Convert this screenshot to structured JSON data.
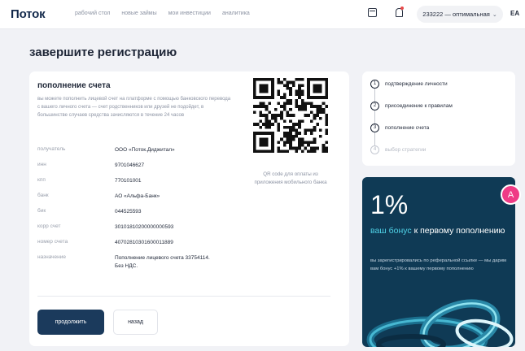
{
  "header": {
    "logo": "Поток",
    "nav": [
      "рабочий стол",
      "новые займы",
      "мои инвестиции",
      "аналитика"
    ],
    "account_label": "233222 — оптимальная",
    "user_initials": "EA"
  },
  "page": {
    "title": "завершите регистрацию"
  },
  "funding": {
    "title": "пополнение счета",
    "description": "вы можете пополнить лицевой счет на платформе с помощью банковского перевода с вашего личного счета — счет родственников или друзей не подойдет, в большинстве случаев средства зачисляются в течение 24 часов",
    "qr_caption": "QR code для оплаты из приложения мобильного банка",
    "details": [
      {
        "label": "получатель",
        "value": "ООО «Поток.Диджитал»"
      },
      {
        "label": "инн",
        "value": "9701046627"
      },
      {
        "label": "кпп",
        "value": "770101001"
      },
      {
        "label": "банк",
        "value": "АО «Альфа-Банк»"
      },
      {
        "label": "бик",
        "value": "044525593"
      },
      {
        "label": "корр счет",
        "value": "30101810200000000593"
      },
      {
        "label": "номер счета",
        "value": "40702810301600011889"
      },
      {
        "label": "назначение",
        "value": "Пополнение лицевого счета 33754114. Без НДС."
      }
    ],
    "continue_label": "продолжить",
    "back_label": "назад"
  },
  "steps": [
    {
      "num": "1",
      "label": "подтверждение личности",
      "active": true
    },
    {
      "num": "2",
      "label": "присоединение к правилам",
      "active": true
    },
    {
      "num": "3",
      "label": "пополнение счета",
      "active": true
    },
    {
      "num": "4",
      "label": "выбор стратегии",
      "active": false
    }
  ],
  "promo": {
    "big": "1%",
    "accent": "ваш бонус",
    "headline_rest": " к первому пополнению",
    "text": "вы зарегистрировались по реферальной ссылке — мы дарим вам бонус +1% к вашему первому пополнению"
  },
  "chat_badge": "A",
  "colors": {
    "primary": "#1b3a5c",
    "promo_bg": "#0f3a55",
    "accent": "#4fd1e6",
    "badge": "#ef3b86"
  },
  "icons": {
    "calendar": "calendar-icon",
    "notifications": "bell-icon",
    "dropdown": "chevron-down-icon"
  }
}
